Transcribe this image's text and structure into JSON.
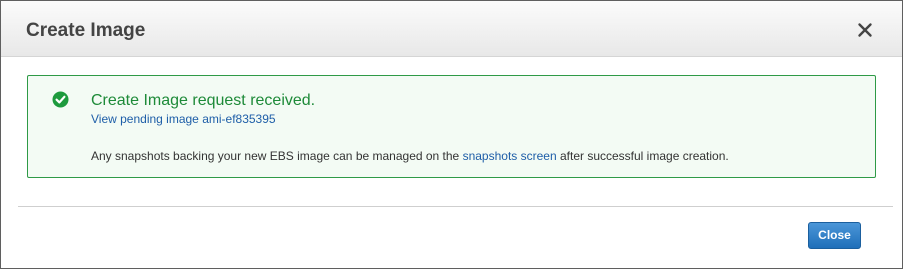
{
  "dialog": {
    "title": "Create Image",
    "close_icon": "close-icon"
  },
  "alert": {
    "status": "success",
    "icon": "check-circle-icon",
    "title": "Create Image request received.",
    "link_text": "View pending image ami-ef835395",
    "body_before": "Any snapshots backing your new EBS image can be managed on the",
    "body_link": "snapshots screen",
    "body_after": "after successful image creation.",
    "colors": {
      "border": "#2e9a46",
      "background": "#f3fbf4",
      "title": "#1d8a38",
      "link": "#1e5ea8"
    }
  },
  "footer": {
    "close_label": "Close",
    "button_color": "#1f6fb9"
  }
}
